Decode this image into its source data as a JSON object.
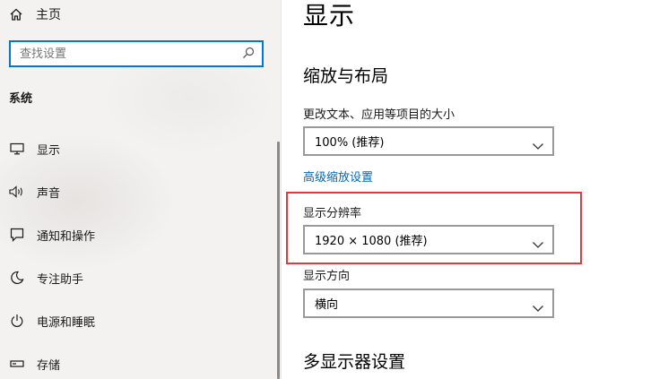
{
  "sidebar": {
    "home_label": "主页",
    "search": {
      "placeholder": "查找设置"
    },
    "section_title": "系统",
    "items": [
      {
        "label": "显示",
        "icon": "monitor-icon"
      },
      {
        "label": "声音",
        "icon": "speaker-icon"
      },
      {
        "label": "通知和操作",
        "icon": "notification-icon"
      },
      {
        "label": "专注助手",
        "icon": "moon-icon"
      },
      {
        "label": "电源和睡眠",
        "icon": "power-icon"
      },
      {
        "label": "存储",
        "icon": "storage-icon"
      }
    ]
  },
  "main": {
    "title": "显示",
    "scale_layout": {
      "heading": "缩放与布局",
      "text_size_label": "更改文本、应用等项目的大小",
      "text_size_value": "100% (推荐)",
      "advanced_link": "高级缩放设置"
    },
    "resolution": {
      "label": "显示分辨率",
      "value": "1920 × 1080 (推荐)"
    },
    "orientation": {
      "label": "显示方向",
      "value": "横向"
    },
    "multi_display_heading": "多显示器设置"
  },
  "colors": {
    "accent": "#0078d7",
    "link": "#0067b8",
    "highlight": "#e0383e"
  }
}
